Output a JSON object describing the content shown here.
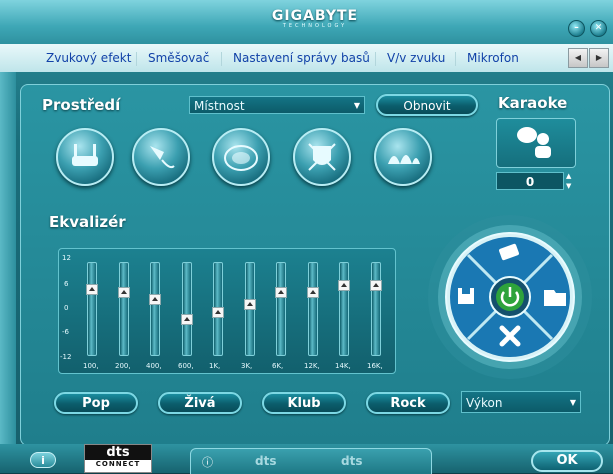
{
  "window": {
    "brand": "GIGABYTE",
    "brand_sub": "TECHNOLOGY",
    "minimize_icon": "minimize-icon",
    "close_icon": "close-icon"
  },
  "tabs": [
    {
      "label": "Zvukový efekt",
      "active": true
    },
    {
      "label": "Směšovač"
    },
    {
      "label": "Nastavení správy basů"
    },
    {
      "label": "V/v zvuku"
    },
    {
      "label": "Mikrofon"
    }
  ],
  "environment": {
    "label": "Prostředí",
    "selected": "Místnost",
    "reset_label": "Obnovit",
    "icons": [
      "bathroom-icon",
      "shower-icon",
      "stadium-icon",
      "colosseum-icon",
      "opera-house-icon"
    ]
  },
  "karaoke": {
    "label": "Karaoke",
    "value": "0",
    "icon": "karaoke-singer-icon"
  },
  "equalizer": {
    "label": "Ekvalizér",
    "scale": [
      "12",
      "6",
      "0",
      "-6",
      "-12"
    ],
    "bands": [
      {
        "freq": "100,",
        "gain": 6
      },
      {
        "freq": "200,",
        "gain": 5
      },
      {
        "freq": "400,",
        "gain": 3
      },
      {
        "freq": "600,",
        "gain": -3
      },
      {
        "freq": "1K,",
        "gain": -1
      },
      {
        "freq": "3K,",
        "gain": 1.5
      },
      {
        "freq": "6K,",
        "gain": 5
      },
      {
        "freq": "12K,",
        "gain": 5
      },
      {
        "freq": "14K,",
        "gain": 7
      },
      {
        "freq": "16K,",
        "gain": 7
      }
    ],
    "presets": [
      "Pop",
      "Živá",
      "Klub",
      "Rock"
    ],
    "preset_select": "Výkon",
    "wheel_icons": [
      "eraser-icon",
      "save-icon",
      "power-icon",
      "open-folder-icon",
      "delete-icon"
    ]
  },
  "footer": {
    "info_label": "i",
    "dts_label": "dts",
    "dts_sub": "CONNECT",
    "ok_label": "OK"
  }
}
